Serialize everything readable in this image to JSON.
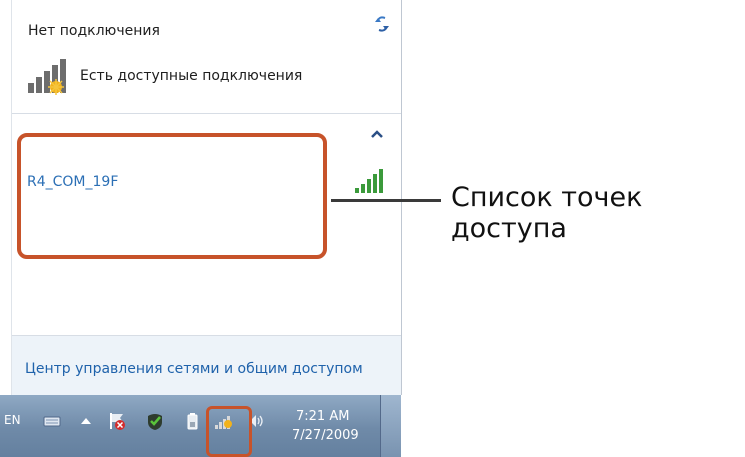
{
  "panel": {
    "status_title": "Нет подключения",
    "status_subtitle": "Есть доступные подключения",
    "networks": [
      {
        "ssid": "R4_COM_19F",
        "signal_icon": "signal-strength-icon"
      }
    ],
    "footer_link": "Центр управления сетями и общим доступом"
  },
  "callout": {
    "label": "Список точек доступа"
  },
  "taskbar": {
    "language": "EN",
    "clock_time": "7:21 AM",
    "clock_date": "7/27/2009",
    "icons": [
      "keyboard-icon",
      "show-hidden-icons-icon",
      "action-center-icon",
      "security-icon",
      "battery-icon",
      "wifi-network-icon",
      "volume-icon"
    ]
  },
  "colors": {
    "highlight": "#c7532a",
    "link": "#1f62ab",
    "taskbar": "#6f8aa8"
  }
}
